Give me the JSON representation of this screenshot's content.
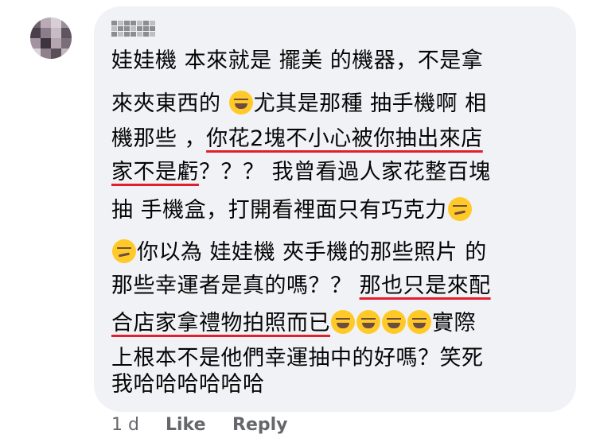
{
  "comment": {
    "lines": [
      {
        "a": "娃娃機 本來就是 擺美 的機器，不是拿"
      },
      {
        "a": "來夾東西的 ",
        "b": "尤其是那種 抽手機啊 相"
      },
      {
        "a": "機那些 ，",
        "u": "你花2塊不小心被你抽出來店"
      },
      {
        "u": "家不是虧",
        "a": "？？？ 我曾看過人家花整百塊"
      },
      {
        "a": "抽 手機盒，打開看裡面只有巧克力"
      },
      {
        "a": "你以為 娃娃機 夾手機的那些照片 的"
      },
      {
        "a": "那些幸運者是真的嗎？？ ",
        "u": "那也只是來配"
      },
      {
        "u": "合店家拿禮物拍照而已",
        "a": "實際"
      },
      {
        "a": "上根本不是他們幸運抽中的好嗎？笑死"
      },
      {
        "a": "我哈哈哈哈哈哈"
      }
    ]
  },
  "actions": {
    "time": "1 d",
    "like": "Like",
    "reply": "Reply"
  },
  "colors": {
    "bubble": "#f0f2f5",
    "underline": "#e0202c",
    "meta": "#65676b"
  }
}
